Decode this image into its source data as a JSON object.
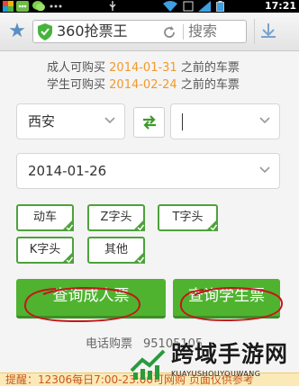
{
  "status_bar": {
    "time": "17:21",
    "icons": [
      "app-icon",
      "msg-icon",
      "wechat-icon",
      "more-icon",
      "usb-icon",
      "wifi-icon",
      "sim-icon",
      "signal-icon",
      "battery-icon"
    ]
  },
  "browser": {
    "title": "360抢票王",
    "search_label": "搜索",
    "icons": [
      "star-icon",
      "shield-icon",
      "reload-icon",
      "download-icon"
    ],
    "accent": "#5a8fc3"
  },
  "notice": {
    "adult_prefix": "成人可购买",
    "adult_date": "2014-01-31",
    "adult_suffix": "之前的车票",
    "student_prefix": "学生可购买",
    "student_date": "2014-02-24",
    "student_suffix": "之前的车票",
    "date_color": "#f19a2c"
  },
  "form": {
    "from_station": "西安",
    "to_station": "",
    "date": "2014-01-26"
  },
  "train_types": [
    {
      "label": "动车",
      "checked": true
    },
    {
      "label": "Z字头",
      "checked": true
    },
    {
      "label": "T字头",
      "checked": true
    },
    {
      "label": "K字头",
      "checked": true
    },
    {
      "label": "其他",
      "checked": true
    }
  ],
  "buttons": {
    "adult": "查询成人票",
    "student": "查询学生票",
    "color": "#4fb32f"
  },
  "footer": {
    "phone_label": "电话购票",
    "phone_number": "95105105",
    "strip_text": "提醒：12306每日7:00-23:00可网购 页面仅供参考"
  },
  "watermark": {
    "title": "跨域手游网",
    "subtitle": "KUAYUSHOUYOUWANG"
  }
}
